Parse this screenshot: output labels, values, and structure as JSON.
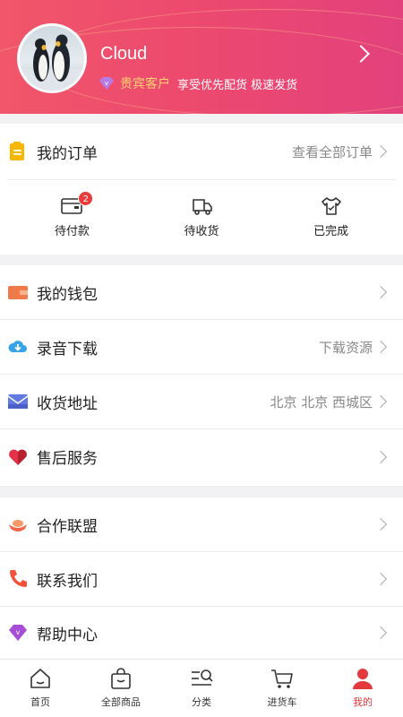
{
  "profile": {
    "username": "Cloud",
    "vip_label": "贵宾客户",
    "vip_perks": "享受优先配货 极速发货"
  },
  "orders": {
    "title": "我的订单",
    "view_all": "查看全部订单",
    "statuses": [
      {
        "label": "待付款",
        "badge": "2",
        "icon": "wallet-icon"
      },
      {
        "label": "待收货",
        "badge": null,
        "icon": "truck-icon"
      },
      {
        "label": "已完成",
        "badge": null,
        "icon": "shirt-icon"
      }
    ]
  },
  "menu_group_1": [
    {
      "label": "我的钱包",
      "value": "",
      "icon": "wallet-icon",
      "color": "#f07a4a"
    },
    {
      "label": "录音下载",
      "value": "下载资源",
      "icon": "cloud-download-icon",
      "color": "#36a4e6"
    },
    {
      "label": "收货地址",
      "value": "北京 北京 西城区",
      "icon": "envelope-icon",
      "color": "#6179e0"
    },
    {
      "label": "售后服务",
      "value": "",
      "icon": "heart-icon",
      "color": "#e2334a"
    }
  ],
  "menu_group_2": [
    {
      "label": "合作联盟",
      "value": "",
      "icon": "ingot-icon",
      "color": "#f2664a"
    },
    {
      "label": "联系我们",
      "value": "",
      "icon": "phone-icon",
      "color": "#f0523a"
    },
    {
      "label": "帮助中心",
      "value": "",
      "icon": "diamond-icon",
      "color": "#a64fd6"
    }
  ],
  "tabbar": [
    {
      "label": "首页",
      "icon": "home-icon"
    },
    {
      "label": "全部商品",
      "icon": "bag-icon"
    },
    {
      "label": "分类",
      "icon": "category-search-icon"
    },
    {
      "label": "进货车",
      "icon": "cart-icon"
    },
    {
      "label": "我的",
      "icon": "person-icon",
      "active": true
    }
  ],
  "colors": {
    "header_start": "#f1566a",
    "header_end": "#e3417c",
    "accent_red": "#e4393c",
    "vip_gold": "#ffd36e"
  }
}
